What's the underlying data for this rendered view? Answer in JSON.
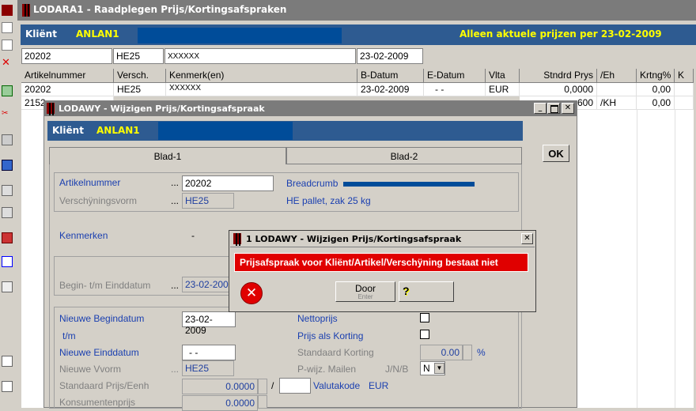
{
  "main": {
    "title": "LODARA1 - Raadplegen Prijs/Kortingsafspraken",
    "klient_label": "Kliënt",
    "klient_code": "ANLAN1",
    "prijzen_text": "Alleen aktuele prijzen per 23-02-2009",
    "filters": [
      "20202",
      "HE25",
      "XXXXXX",
      "23-02-2009"
    ],
    "columns": [
      "Artikelnummer",
      "Versch.",
      "Kenmerk(en)",
      "B-Datum",
      "E-Datum",
      "Vlta",
      "Stndrd Prys",
      "/Eh",
      "Krtng%",
      "K"
    ],
    "rows": [
      [
        "20202",
        "HE25",
        "XXXXXX",
        "23-02-2009",
        "- -",
        "EUR",
        "0,0000",
        "",
        "0,00",
        ""
      ],
      [
        "2152",
        "",
        "",
        "",
        "",
        "",
        "600",
        "/KH",
        "0,00",
        ""
      ]
    ]
  },
  "sub": {
    "title": "LODAWY - Wijzigen Prijs/Kortingsafspraak",
    "klient_label": "Kliënt",
    "klient_code": "ANLAN1",
    "tabs": [
      "Blad-1",
      "Blad-2"
    ],
    "ok_label": "OK",
    "artikelnummer_label": "Artikelnummer",
    "artikelnummer_value": "20202",
    "breadcrumb_text": "Breadcrumb",
    "verschijningsvorm_label": "Verschÿningsvorm",
    "verschijningsvorm_value": "HE25",
    "verschijningsvorm_desc": "HE pallet, zak 25 kg",
    "kenmerken_label": "Kenmerken",
    "kenmerken_value": "-",
    "begin_einddatum_label": "Begin- t/m Einddatum",
    "begin_einddatum_value": "23-02-2009",
    "nieuwe_begindatum_label": "Nieuwe Begindatum",
    "nieuwe_begindatum_value": "23-02-2009",
    "tm_label": "t/m",
    "nieuwe_einddatum_label": "Nieuwe Einddatum",
    "nieuwe_einddatum_value": "- -",
    "nieuwe_vorm_label": "Nieuwe Vvorm",
    "nieuwe_vorm_value": "HE25",
    "standaard_prijs_label": "Standaard Prijs/Eenh",
    "standaard_prijs_value": "0.0000",
    "slash": "/",
    "valutakode_label": "Valutakode",
    "valutakode_value": "EUR",
    "konsumentenprijs_label": "Konsumentenprijs",
    "konsumentenprijs_value": "0.0000",
    "nettoprijs_label": "Nettoprijs",
    "prijs_als_korting_label": "Prijs als Korting",
    "standaard_korting_label": "Standaard Korting",
    "standaard_korting_value": "0.00",
    "percent": "%",
    "pwijz_label": "P-wijz. Mailen",
    "jnb_label": "J/N/B",
    "pwijz_value": "N",
    "dots": "..."
  },
  "dialog": {
    "title": "1 LODAWY - Wijzigen Prijs/Kortingsafspraak",
    "message": "Prijsafspraak voor Kliënt/Artikel/Verschÿning bestaat niet",
    "door_label": "Door",
    "door_sub": "Enter",
    "help_glyph": "?"
  },
  "colors": {
    "title_inactive": "#7b7b7b",
    "title_active": "#0a246a",
    "client_bar": "#2e5b91",
    "accent_yellow": "#ffff00",
    "error_red": "#e00000"
  }
}
